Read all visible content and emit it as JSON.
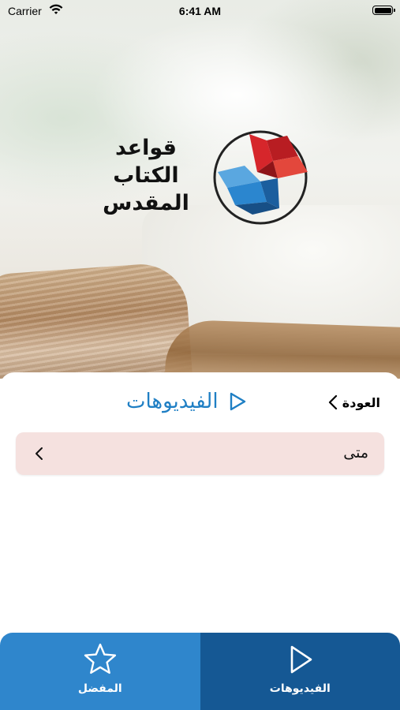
{
  "status_bar": {
    "carrier": "Carrier",
    "time": "6:41 AM",
    "wifi_icon": "wifi-icon",
    "battery_icon": "battery-icon"
  },
  "logo": {
    "lines": [
      "قواعد",
      "الكتاب",
      "المقدس"
    ],
    "mark_icon": "open-book-logo-icon",
    "colors": {
      "red": "#d6262b",
      "blue": "#2b86cf",
      "ring": "#222222"
    }
  },
  "header": {
    "title": "الفيديوهات",
    "title_icon": "play-icon",
    "back_label": "العودة",
    "back_icon": "chevron-left-icon"
  },
  "list": {
    "items": [
      {
        "label": "متى",
        "icon": "chevron-left-icon"
      }
    ]
  },
  "tabbar": {
    "tabs": [
      {
        "label": "المفضل",
        "icon": "star-icon",
        "active": false
      },
      {
        "label": "الفيديوهات",
        "icon": "play-icon",
        "active": true
      }
    ]
  },
  "colors": {
    "accent": "#1f7fc4",
    "list_bg": "#f5e1df",
    "tab_inactive": "#2f86cc",
    "tab_active": "#155894"
  }
}
